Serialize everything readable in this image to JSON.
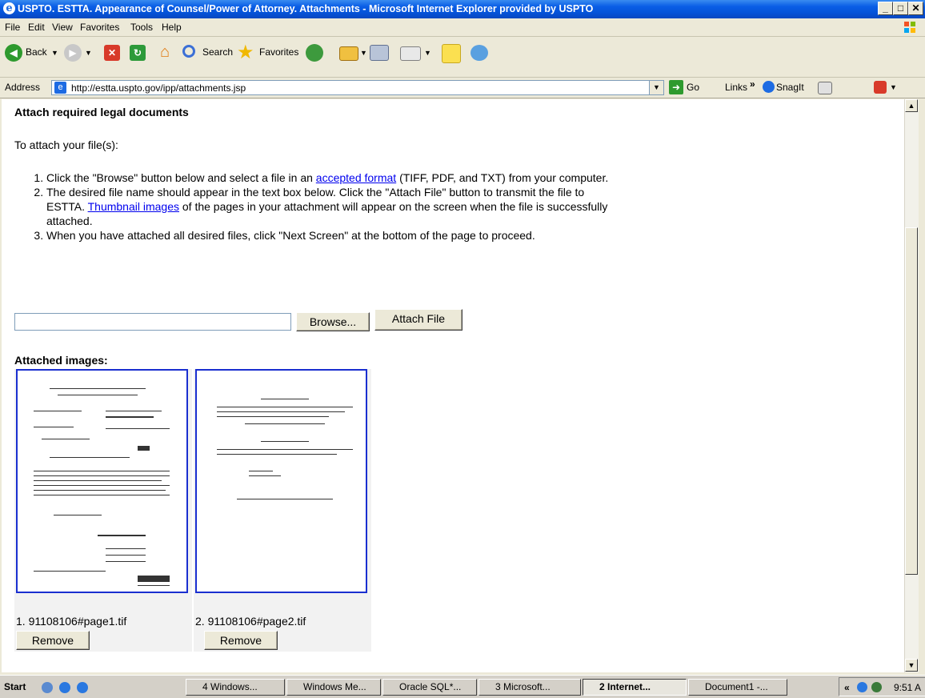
{
  "window": {
    "title": "USPTO. ESTTA. Appearance of Counsel/Power of Attorney. Attachments - Microsoft Internet Explorer provided by USPTO"
  },
  "menu": [
    "File",
    "Edit",
    "View",
    "Favorites",
    "Tools",
    "Help"
  ],
  "toolbar": {
    "back": "Back",
    "search": "Search",
    "favorites": "Favorites"
  },
  "address": {
    "label": "Address",
    "url": "http://estta.uspto.gov/ipp/attachments.jsp",
    "go": "Go",
    "links": "Links",
    "chevron": "»",
    "snagit": "SnagIt"
  },
  "page": {
    "heading": "Attach required legal documents",
    "intro": "To attach your file(s):",
    "steps": {
      "s1_pre": "Click the \"Browse\" button below and select a file in an ",
      "s1_link": "accepted format",
      "s1_post": " (TIFF, PDF, and TXT) from your computer.",
      "s2_pre": "The desired file name should appear in the text box below. Click the \"Attach File\" button to transmit the file to ESTTA. ",
      "s2_link": "Thumbnail images",
      "s2_post": " of the pages in your attachment will appear on the screen when the file is successfully attached.",
      "s3": "When you have attached all desired files, click \"Next Screen\" at the bottom of the page to proceed."
    },
    "file_input_value": "",
    "browse_label": "Browse...",
    "attach_label": "Attach File",
    "attached_heading": "Attached images:",
    "attachments": [
      {
        "caption": "1. 91108106#page1.tif",
        "remove": "Remove"
      },
      {
        "caption": "2. 91108106#page2.tif",
        "remove": "Remove"
      }
    ]
  },
  "taskbar": {
    "start": "Start",
    "items": [
      "4 Windows...",
      "Windows Me...",
      "Oracle SQL*...",
      "3 Microsoft...",
      "2 Internet...",
      "Document1 -..."
    ],
    "chevron": "«",
    "clock": "9:51 A"
  }
}
